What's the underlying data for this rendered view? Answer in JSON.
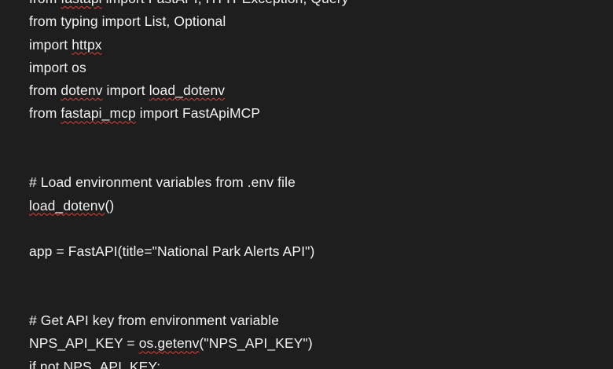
{
  "editor": {
    "background": "#1e1e1e",
    "text_color": "#f2f2f2",
    "spell_error_color": "#e0413a",
    "lines": [
      [
        {
          "t": "from "
        },
        {
          "t": "fastapi",
          "s": true
        },
        {
          "t": " import FastAPI, HTTPException, Query"
        }
      ],
      [
        {
          "t": "from typing import List, Optional"
        }
      ],
      [
        {
          "t": "import "
        },
        {
          "t": "httpx",
          "s": true
        }
      ],
      [
        {
          "t": "import os"
        }
      ],
      [
        {
          "t": "from "
        },
        {
          "t": "dotenv",
          "s": true
        },
        {
          "t": " import "
        },
        {
          "t": "load_dotenv",
          "s": true
        }
      ],
      [
        {
          "t": "from "
        },
        {
          "t": "fastapi_mcp",
          "s": true
        },
        {
          "t": " import FastApiMCP"
        }
      ],
      [],
      [],
      [
        {
          "t": "# Load environment variables from .env file"
        }
      ],
      [
        {
          "t": "load_dotenv",
          "s": true
        },
        {
          "t": "()"
        }
      ],
      [],
      [
        {
          "t": "app = FastAPI(title=\"National Park Alerts API\")"
        }
      ],
      [],
      [],
      [
        {
          "t": "# Get API key from environment variable"
        }
      ],
      [
        {
          "t": "NPS_API_KEY = "
        },
        {
          "t": "os.getenv",
          "s": true
        },
        {
          "t": "(\"NPS_API_KEY\")"
        }
      ],
      [
        {
          "t": "if not NPS_API_KEY:"
        }
      ]
    ]
  }
}
